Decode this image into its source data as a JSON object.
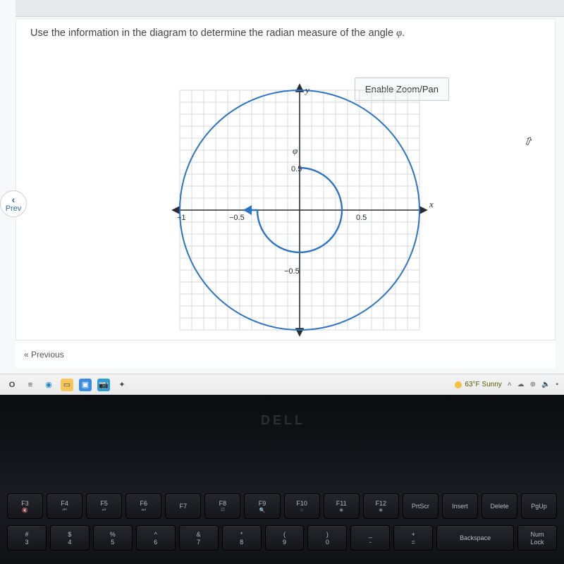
{
  "question": {
    "text_prefix": "Use the information in the diagram to determine the radian measure of the angle ",
    "symbol": "φ",
    "text_suffix": "."
  },
  "controls": {
    "zoom_pan": "Enable Zoom/Pan",
    "prev_label": "Prev",
    "previous_link": "« Previous"
  },
  "axis_labels": {
    "y": "y",
    "x": "x",
    "phi": "φ",
    "p05": "0.5",
    "n05x": "−0.5",
    "n1x": "−1",
    "p05x": "0.5",
    "n05y": "−0.5"
  },
  "taskbar": {
    "weather": "63°F Sunny",
    "icons": [
      "O",
      "≡",
      "●",
      "📁",
      "⏵",
      "📷",
      "✦"
    ]
  },
  "laptop": {
    "brand": "DELL",
    "function_row": [
      {
        "main": "F3",
        "sub": "🔇"
      },
      {
        "main": "F4",
        "sub": "⏮"
      },
      {
        "main": "F5",
        "sub": "⏯"
      },
      {
        "main": "F6",
        "sub": "⏭"
      },
      {
        "main": "F7",
        "sub": ""
      },
      {
        "main": "F8",
        "sub": "⎚"
      },
      {
        "main": "F9",
        "sub": "🔍"
      },
      {
        "main": "F10",
        "sub": "☼"
      },
      {
        "main": "F11",
        "sub": "✱"
      },
      {
        "main": "F12",
        "sub": "✱"
      },
      {
        "main": "PrtScr",
        "sub": ""
      },
      {
        "main": "Insert",
        "sub": ""
      },
      {
        "main": "Delete",
        "sub": ""
      },
      {
        "main": "PgUp",
        "sub": ""
      }
    ],
    "number_row": [
      {
        "top": "#",
        "bot": "3"
      },
      {
        "top": "$",
        "bot": "4"
      },
      {
        "top": "%",
        "bot": "5"
      },
      {
        "top": "^",
        "bot": "6"
      },
      {
        "top": "&",
        "bot": "7"
      },
      {
        "top": "*",
        "bot": "8"
      },
      {
        "top": "(",
        "bot": "9"
      },
      {
        "top": ")",
        "bot": "0"
      },
      {
        "top": "_",
        "bot": "-"
      },
      {
        "top": "+",
        "bot": "="
      },
      {
        "top": "Backspace",
        "bot": ""
      },
      {
        "top": "Num",
        "bot": "Lock"
      }
    ]
  }
}
